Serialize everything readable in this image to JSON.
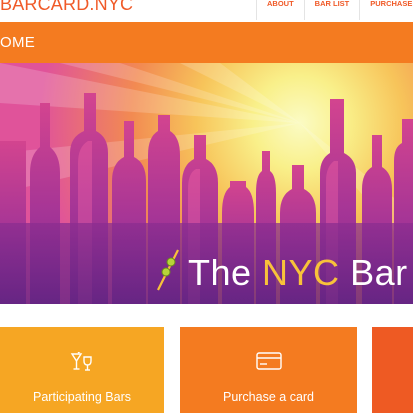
{
  "header": {
    "logo_text": "BARCARD.NYC",
    "nav": [
      {
        "label": "ABOUT"
      },
      {
        "label": "BAR LIST"
      },
      {
        "label": "PURCHASE"
      }
    ]
  },
  "breadcrumb": {
    "text": "OME"
  },
  "hero": {
    "title_prefix": "The ",
    "title_highlight": "NYC",
    "title_suffix": " Bar"
  },
  "tiles": [
    {
      "label": "Participating Bars",
      "icon": "drinks-icon"
    },
    {
      "label": "Purchase a card",
      "icon": "card-icon"
    },
    {
      "label": "",
      "icon": ""
    }
  ],
  "colors": {
    "brand_orange": "#f05a28",
    "banner_orange": "#f47b20",
    "tile_yellow": "#f6a623",
    "hero_purple": "#8e2b8e",
    "hero_yellow": "#f8c23a"
  }
}
